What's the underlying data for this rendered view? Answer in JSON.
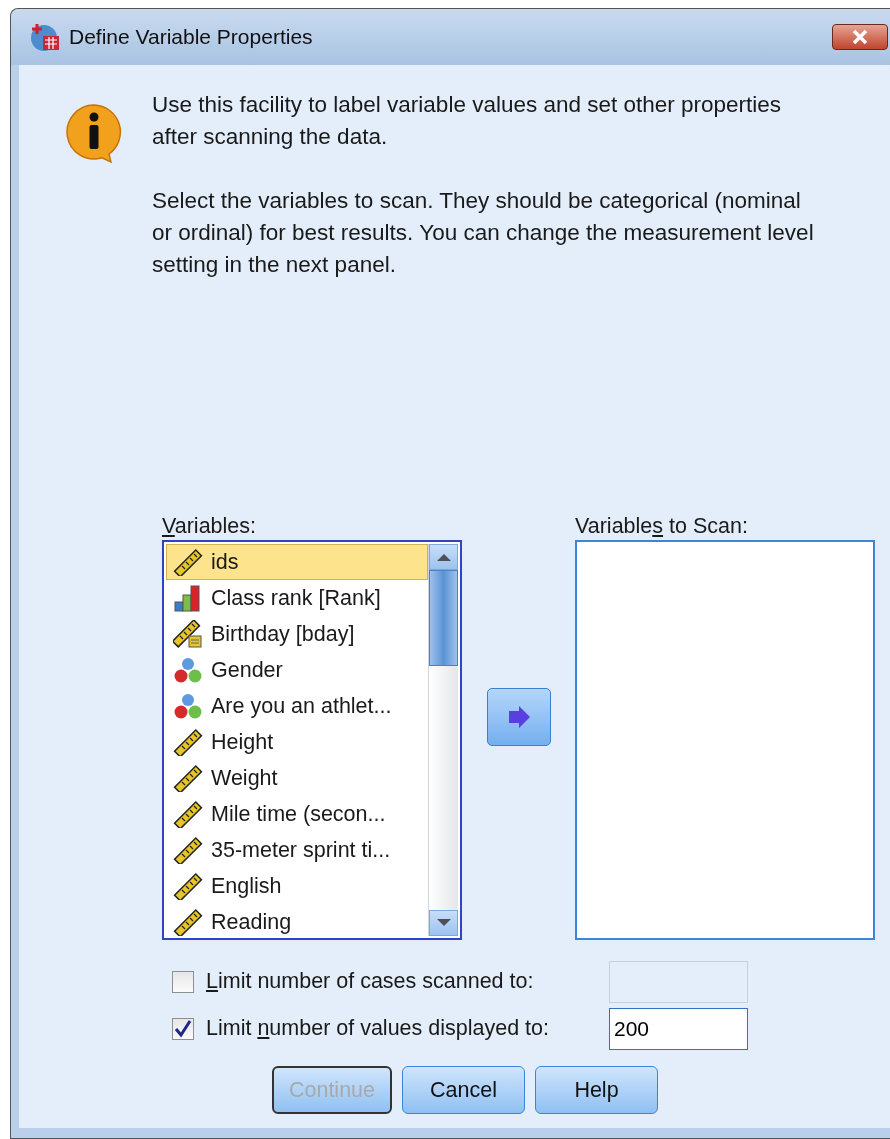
{
  "window": {
    "title": "Define Variable Properties"
  },
  "info": {
    "paragraphs": [
      "Use this facility to label variable values and set other properties after scanning the data.",
      "Select the variables to scan. They should be categorical (nominal or ordinal) for best results. You can change the measurement level setting in the next panel."
    ]
  },
  "variables": {
    "label": {
      "key": "V",
      "post": "ariables:"
    },
    "items": [
      {
        "text": "ids",
        "kind": "scale",
        "selected": true
      },
      {
        "text": "Class rank [Rank]",
        "kind": "ordinal",
        "selected": false
      },
      {
        "text": "Birthday [bday]",
        "kind": "date",
        "selected": false
      },
      {
        "text": "Gender",
        "kind": "nominal",
        "selected": false
      },
      {
        "text": "Are you an athlet...",
        "kind": "nominal",
        "selected": false
      },
      {
        "text": "Height",
        "kind": "scale",
        "selected": false
      },
      {
        "text": "Weight",
        "kind": "scale",
        "selected": false
      },
      {
        "text": "Mile time (secon...",
        "kind": "scale",
        "selected": false
      },
      {
        "text": "35-meter sprint ti...",
        "kind": "scale",
        "selected": false
      },
      {
        "text": "English",
        "kind": "scale",
        "selected": false
      },
      {
        "text": "Reading",
        "kind": "scale",
        "selected": false
      }
    ]
  },
  "scan_list": {
    "label": {
      "pre": "Variable",
      "key": "s",
      "post": " to Scan:"
    }
  },
  "options": [
    {
      "label": {
        "key": "L",
        "post": "imit number of cases scanned to:"
      },
      "checked": false,
      "field_disabled": true
    },
    {
      "label": {
        "pre": "Limit ",
        "key": "n",
        "post": "umber of values displayed to:"
      },
      "checked": true,
      "field_disabled": false,
      "value": "200"
    }
  ],
  "buttons": [
    {
      "label": "Continue",
      "disabled": true,
      "default": true
    },
    {
      "label": "Cancel",
      "disabled": false,
      "default": false
    },
    {
      "label": "Help",
      "disabled": false,
      "default": false
    }
  ]
}
